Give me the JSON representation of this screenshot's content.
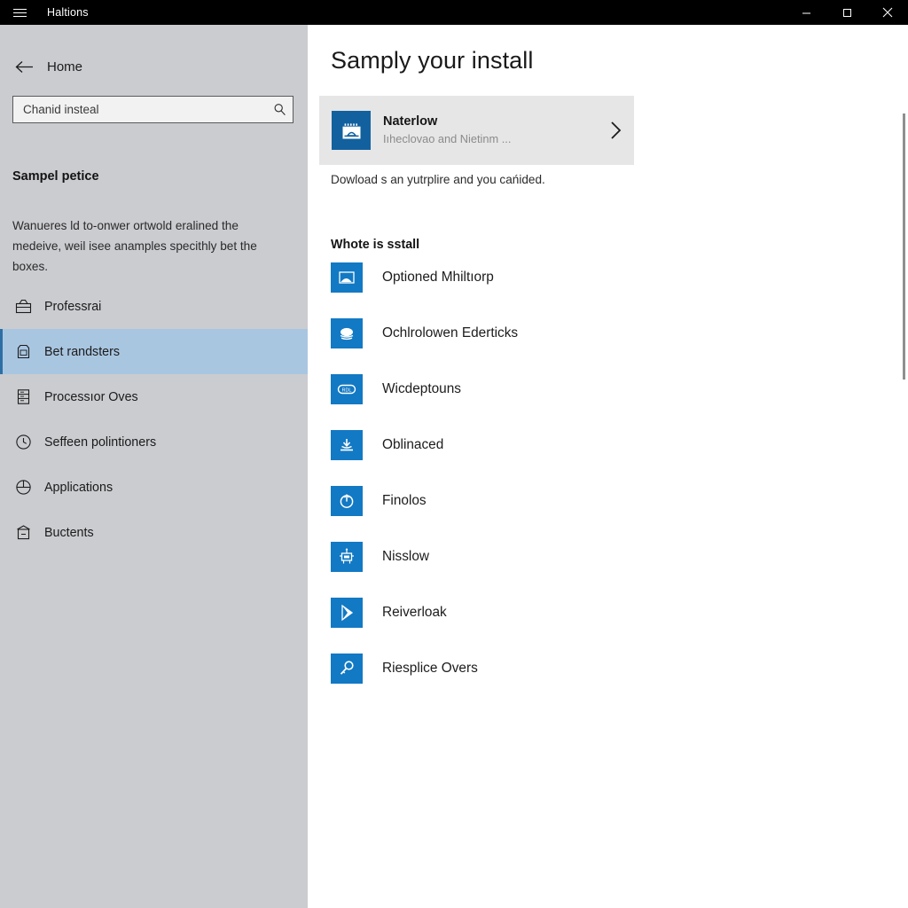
{
  "window": {
    "title": "Haltions",
    "menu_icon": "hamburger-icon",
    "minimize_label": "Minimize",
    "maximize_label": "Maximize",
    "close_label": "Close"
  },
  "sidebar": {
    "back_label": "Home",
    "search": {
      "value": "",
      "placeholder": "Chanid insteal",
      "icon": "search-icon"
    },
    "heading": "Sampel petice",
    "description": "Wanueres ld to-onwer ortwold eralined the medeive, weil isee anamples specithly bet the boxes.",
    "items": [
      {
        "label": "Professrai",
        "icon": "toolbox-icon",
        "selected": false
      },
      {
        "label": "Bet randsters",
        "icon": "bag-icon",
        "selected": true
      },
      {
        "label": "Processıor Oves",
        "icon": "server-icon",
        "selected": false
      },
      {
        "label": "Seffeen polintioners",
        "icon": "clock-icon",
        "selected": false
      },
      {
        "label": "Applications",
        "icon": "globe-icon",
        "selected": false
      },
      {
        "label": "Buctents",
        "icon": "archive-icon",
        "selected": false
      }
    ],
    "background_color": "#cbccd0",
    "selected_color": "#a9c6e1",
    "accent_color": "#2f6ea5"
  },
  "main": {
    "page_title": "Samply your install",
    "featured": {
      "name": "Naterlow",
      "subtitle": "Iıheclovao and Nietinm   ...",
      "icon": "calendar-store-icon",
      "chevron": "chevron-right-icon",
      "tile_color": "#12619e",
      "card_color": "#e6e6e6"
    },
    "card_note": "Dowload s an yutrplire and you cańided.",
    "section_heading": "Whote is sstall",
    "apps": [
      {
        "label": "Optioned Mhiltıorp",
        "icon": "image-icon"
      },
      {
        "label": "Ochlrolowen Ederticks",
        "icon": "cloud-icon"
      },
      {
        "label": "Wicdeptouns",
        "icon": "pill-badge-icon"
      },
      {
        "label": "Oblinaced",
        "icon": "download-icon"
      },
      {
        "label": "Finolos",
        "icon": "refresh-circle-icon"
      },
      {
        "label": "Nisslow",
        "icon": "robot-icon"
      },
      {
        "label": "Reiverloak",
        "icon": "play-icon"
      },
      {
        "label": "Riesplice Overs",
        "icon": "key-icon"
      }
    ],
    "tile_color": "#1279c4",
    "background_color": "#ffffff"
  },
  "scrollbar": {
    "present": true
  }
}
